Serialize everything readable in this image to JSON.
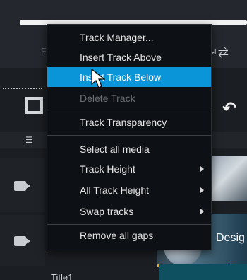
{
  "context_menu": {
    "items": [
      {
        "label": "Track Manager...",
        "highlighted": false,
        "disabled": false,
        "submenu": false
      },
      {
        "label": "Insert Track Above",
        "highlighted": false,
        "disabled": false,
        "submenu": false
      },
      {
        "label": "Insert Track Below",
        "highlighted": true,
        "disabled": false,
        "submenu": false
      },
      {
        "label": "Delete Track",
        "highlighted": false,
        "disabled": true,
        "submenu": false
      },
      {
        "label": "Track Transparency",
        "highlighted": false,
        "disabled": false,
        "submenu": false
      },
      {
        "label": "Select all media",
        "highlighted": false,
        "disabled": false,
        "submenu": false
      },
      {
        "label": "Track Height",
        "highlighted": false,
        "disabled": false,
        "submenu": true
      },
      {
        "label": "All Track Height",
        "highlighted": false,
        "disabled": false,
        "submenu": true
      },
      {
        "label": "Swap tracks",
        "highlighted": false,
        "disabled": false,
        "submenu": true
      },
      {
        "label": "Remove all gaps",
        "highlighted": false,
        "disabled": false,
        "submenu": false
      }
    ]
  },
  "background": {
    "partial_letter": "F",
    "clip_label": "Desig",
    "timeline_title": "Title1"
  },
  "colors": {
    "highlight": "#0a95d8",
    "menu_bg": "#0d1014"
  }
}
